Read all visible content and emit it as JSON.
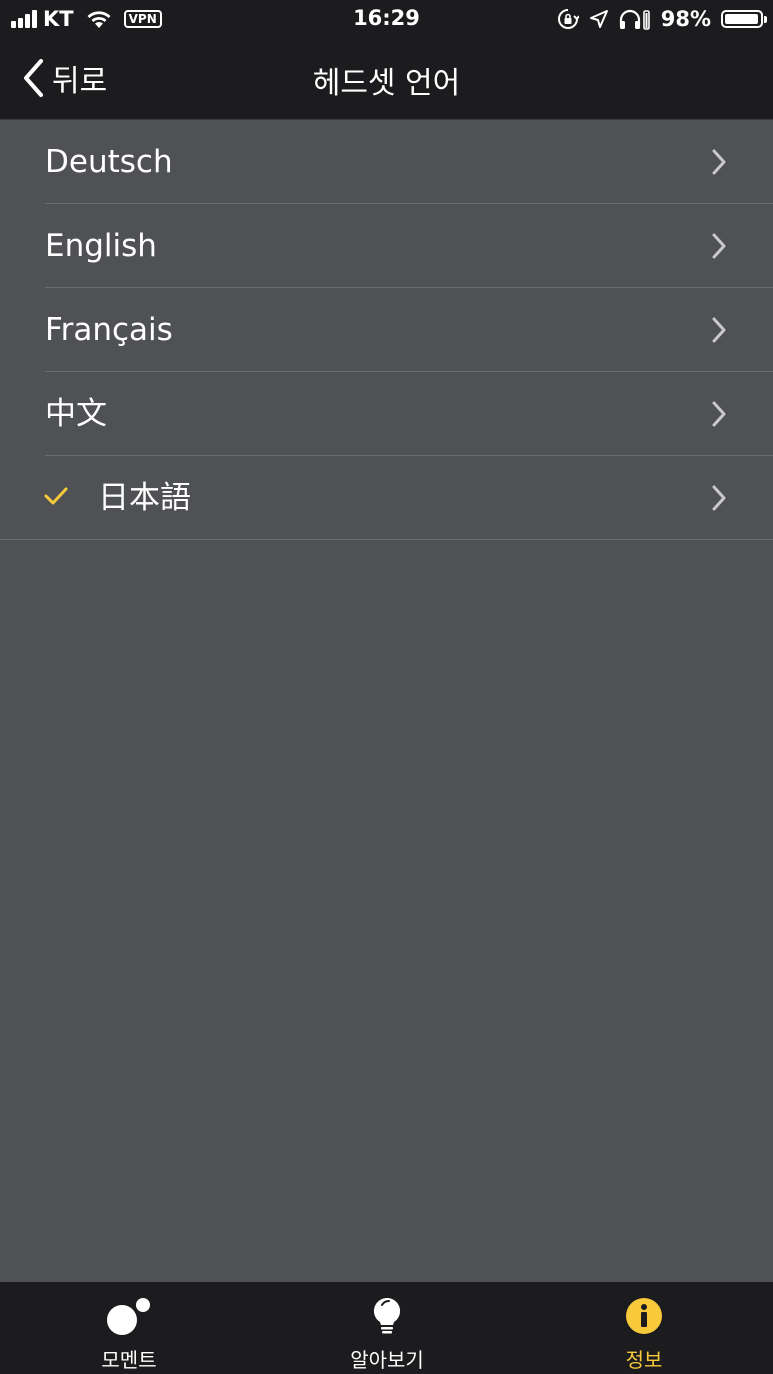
{
  "status_bar": {
    "carrier": "KT",
    "vpn": "VPN",
    "time": "16:29",
    "battery_percent": "98%",
    "battery_level": 0.98,
    "icons": [
      "cellular-signal-icon",
      "wifi-icon",
      "vpn-icon",
      "rotation-lock-icon",
      "location-icon",
      "headphones-battery-icon",
      "battery-icon"
    ]
  },
  "nav": {
    "back_label": "뒤로",
    "title": "헤드셋 언어"
  },
  "languages": [
    {
      "label": "Deutsch",
      "selected": false
    },
    {
      "label": "English",
      "selected": false
    },
    {
      "label": "Français",
      "selected": false
    },
    {
      "label": "中文",
      "selected": false
    },
    {
      "label": "日本語",
      "selected": true
    }
  ],
  "tabs": [
    {
      "label": "모멘트",
      "icon": "moments-icon",
      "active": false
    },
    {
      "label": "알아보기",
      "icon": "lightbulb-icon",
      "active": false
    },
    {
      "label": "정보",
      "icon": "info-icon",
      "active": true
    }
  ],
  "colors": {
    "accent": "#f7c93b",
    "background": "#505155",
    "bar_background": "#1c1c1e",
    "separator": "#6b6c70"
  }
}
